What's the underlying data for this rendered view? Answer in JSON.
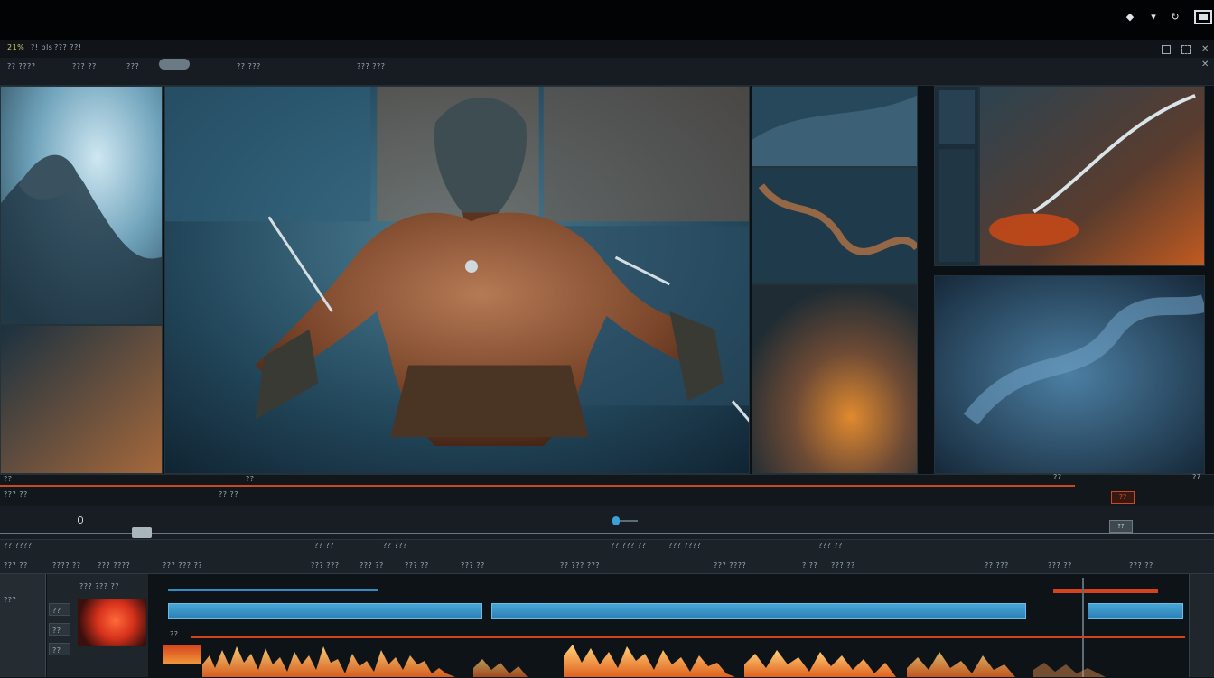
{
  "title_bar": {
    "icons": [
      "diamond-icon",
      "funnel-icon",
      "refresh-icon",
      "panel-icon"
    ]
  },
  "menubar": {
    "items": [
      "21% ",
      "?! bls",
      "??? ??!"
    ],
    "item_1": "21% ",
    "item_2": "?! bls",
    "item_3": "??? ??!"
  },
  "toolbar": {
    "left_items": [
      "?? ????",
      "??? ??",
      "???"
    ],
    "mid_item": "?? ???",
    "right_item": "??? ???",
    "item_1": "?? ????",
    "item_2": "??? ??",
    "item_3": "???",
    "item_4": "?? ???",
    "item_5": "??? ???",
    "right_icons": [
      "box-icon",
      "grid-icon",
      "x-icon"
    ]
  },
  "scrub": {
    "left_time": "??",
    "left_time2": "??? ??",
    "mid_time": "?? ??",
    "mid_mark": "??",
    "right_time": "??",
    "right_time2": "??",
    "record_label": "??"
  },
  "transport": {
    "zoom_label": "??"
  },
  "track_headers": {
    "row1": [
      "?? ????",
      "?? ??",
      "?? ???",
      "?? ??? ??",
      "??? ????",
      "??? ??"
    ],
    "row2": [
      "??? ??",
      "???? ??",
      "??? ????",
      "??? ??? ??",
      "??? ???",
      "??? ??",
      "??? ??",
      "??? ??",
      "?? ??? ???",
      "??? ????",
      "? ??",
      "??? ??",
      "?? ???",
      "??? ??",
      "??? ??"
    ]
  },
  "timeline": {
    "clip_label": "??? ??? ??",
    "track_labels": [
      "???",
      "??",
      "??",
      "??"
    ],
    "audio_label": "??"
  },
  "colors": {
    "accent_orange": "#c94a22",
    "clip_blue": "#3b95c8",
    "waveform_orange": "#f0a33a"
  }
}
